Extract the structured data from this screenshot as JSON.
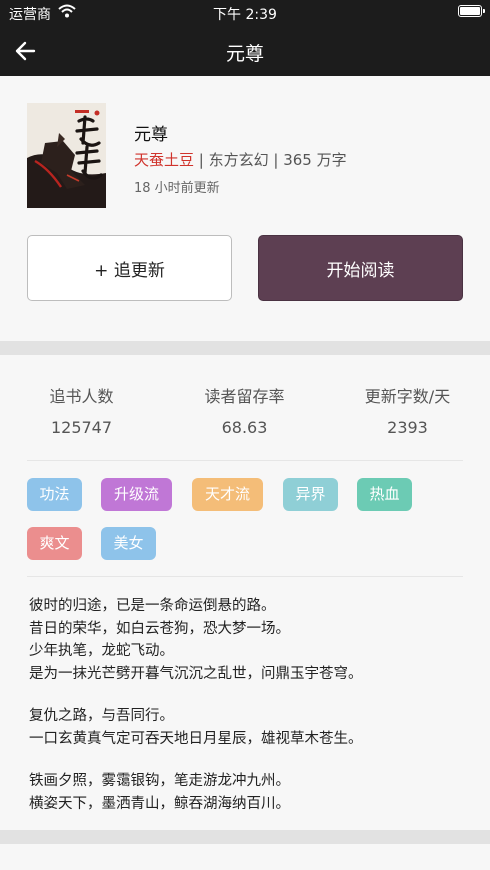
{
  "status_bar": {
    "carrier": "运营商",
    "time": "下午 2:39"
  },
  "nav": {
    "title": "元尊"
  },
  "book": {
    "title": "元尊",
    "author": "天蚕土豆",
    "meta_rest": " | 东方玄幻 | 365 万字",
    "updated": "18 小时前更新"
  },
  "actions": {
    "follow_label": "+ 追更新",
    "read_label": "开始阅读"
  },
  "stats": [
    {
      "label": "追书人数",
      "value": "125747"
    },
    {
      "label": "读者留存率",
      "value": "68.63"
    },
    {
      "label": "更新字数/天",
      "value": "2393"
    }
  ],
  "tags": [
    {
      "label": "功法",
      "color": "#8ec3ea"
    },
    {
      "label": "升级流",
      "color": "#c077d6"
    },
    {
      "label": "天才流",
      "color": "#f4bd78"
    },
    {
      "label": "异界",
      "color": "#8fcfd6"
    },
    {
      "label": "热血",
      "color": "#6ccbb4"
    },
    {
      "label": "爽文",
      "color": "#eb8e8e"
    },
    {
      "label": "美女",
      "color": "#8ec3ea"
    }
  ],
  "synopsis": [
    [
      "彼时的归途，已是一条命运倒悬的路。",
      "昔日的荣华，如白云苍狗，恐大梦一场。",
      "少年执笔，龙蛇飞动。",
      "是为一抹光芒劈开暮气沉沉之乱世，问鼎玉宇苍穹。"
    ],
    [
      "复仇之路，与吾同行。",
      "一口玄黄真气定可吞天地日月星辰，雄视草木苍生。"
    ],
    [
      "铁画夕照，雾霭银钩，笔走游龙冲九州。",
      "横姿天下，墨洒青山，鲸吞湖海纳百川。"
    ]
  ]
}
